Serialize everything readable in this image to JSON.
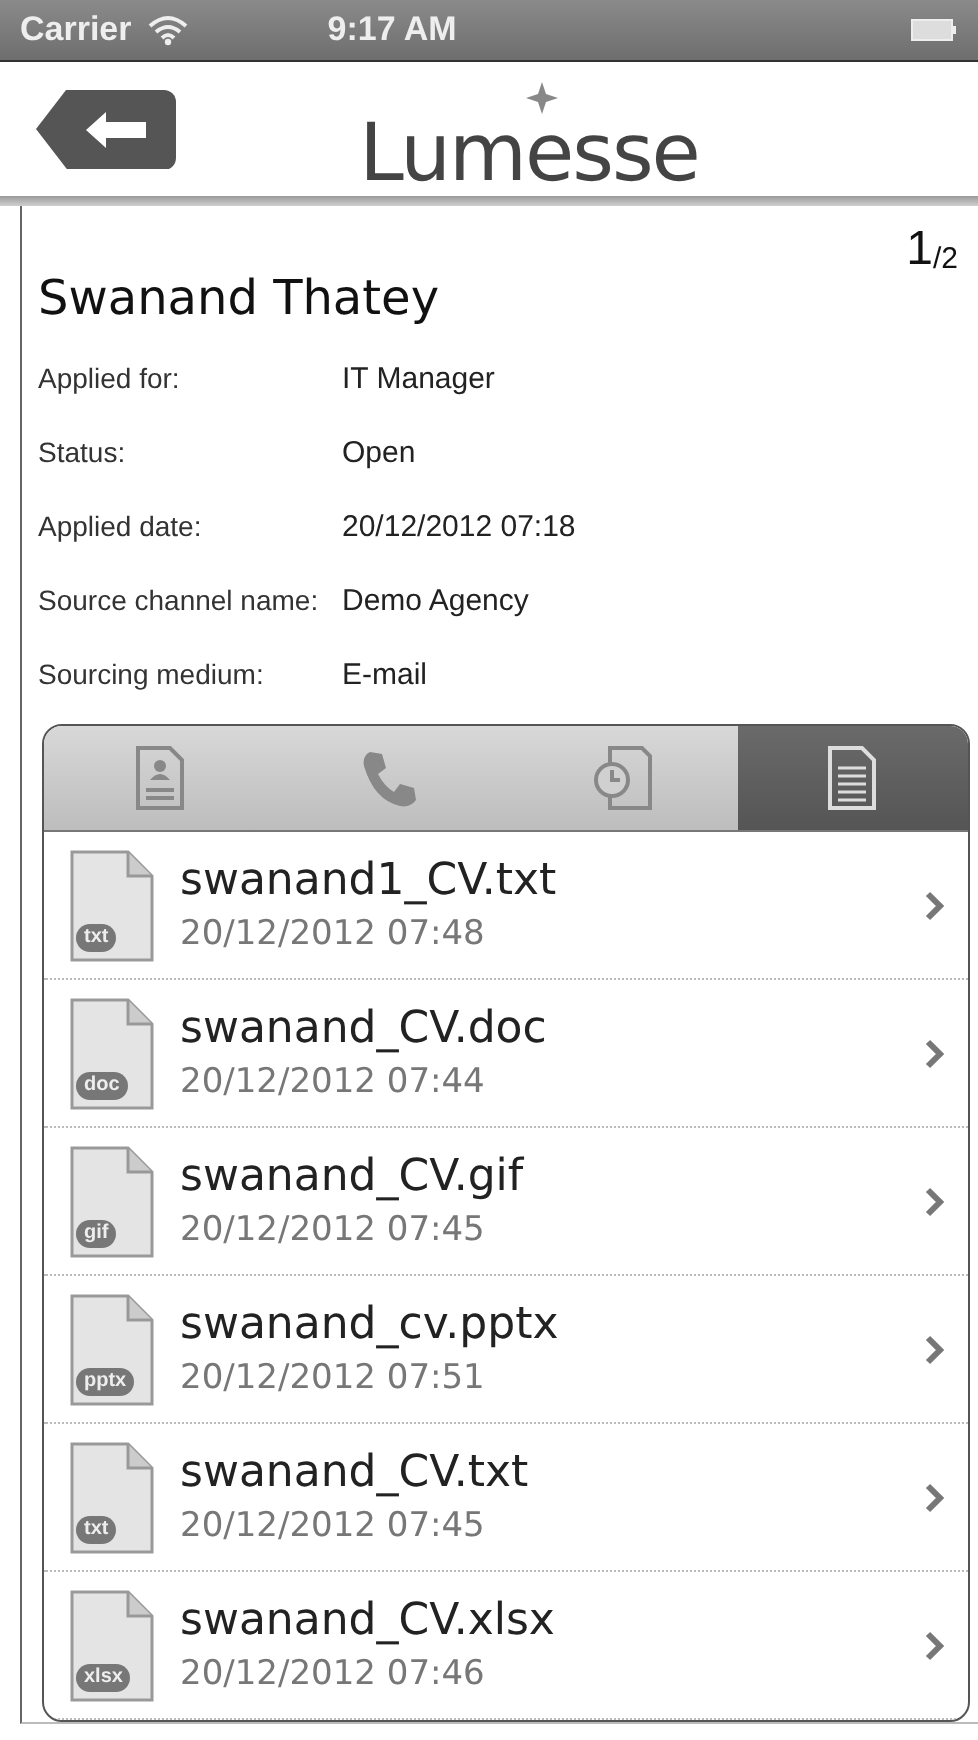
{
  "status_bar": {
    "carrier": "Carrier",
    "time": "9:17 AM"
  },
  "header": {
    "logo": "Lumesse"
  },
  "candidate": {
    "name": "Swanand Thatey",
    "page_indicator": "1$_{/2}$",
    "details": [
      {
        "label": "Applied for:",
        "value": "IT Manager"
      },
      {
        "label": "Status:",
        "value": "Open"
      },
      {
        "label": "Applied date:",
        "value": "20/12/2012 07:18"
      },
      {
        "label": "Source channel name:",
        "value": "Demo Agency"
      },
      {
        "label": "Sourcing medium:",
        "value": "E-mail"
      }
    ]
  },
  "tabs": [
    {
      "kind": "profile",
      "selected": false
    },
    {
      "kind": "phone",
      "selected": false
    },
    {
      "kind": "history",
      "selected": false
    },
    {
      "kind": "documents",
      "selected": true
    }
  ],
  "documents": [
    {
      "name": "swanand1_CV.txt",
      "date": "20/12/2012 07:48",
      "badge": "txt"
    },
    {
      "name": "swanand_CV.doc",
      "date": "20/12/2012 07:44",
      "badge": "doc"
    },
    {
      "name": "swanand_CV.gif",
      "date": "20/12/2012 07:45",
      "badge": "gif"
    },
    {
      "name": "swanand_cv.pptx",
      "date": "20/12/2012 07:51",
      "badge": "pptx"
    },
    {
      "name": "swanand_CV.txt",
      "date": "20/12/2012 07:45",
      "badge": "txt"
    },
    {
      "name": "swanand_CV.xlsx",
      "date": "20/12/2012 07:46",
      "badge": "xlsx"
    }
  ]
}
